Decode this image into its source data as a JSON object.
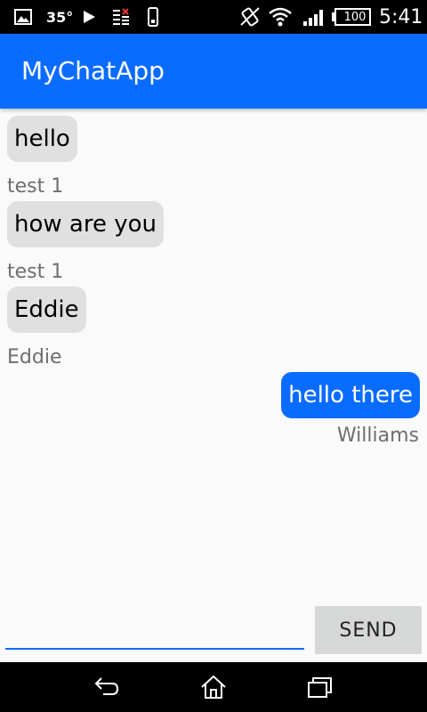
{
  "status_bar": {
    "temperature": "35°",
    "battery": "100",
    "time": "5:41",
    "icons": [
      "image-icon",
      "play-icon",
      "download-icon",
      "phone-icon",
      "vibrate-icon",
      "wifi-icon",
      "signal-icon",
      "battery-icon"
    ]
  },
  "app_bar": {
    "title": "MyChatApp",
    "color": "#0a6cff"
  },
  "messages": [
    {
      "text": "hello",
      "sender": "test 1",
      "direction": "incoming"
    },
    {
      "text": "how are you",
      "sender": "test 1",
      "direction": "incoming"
    },
    {
      "text": "Eddie",
      "sender": "Eddie",
      "direction": "incoming"
    },
    {
      "text": "hello there",
      "sender": "Williams",
      "direction": "outgoing"
    }
  ],
  "composer": {
    "input_value": "",
    "send_label": "SEND"
  },
  "nav_bar": {
    "icons": [
      "back-icon",
      "home-icon",
      "recent-apps-icon"
    ]
  }
}
